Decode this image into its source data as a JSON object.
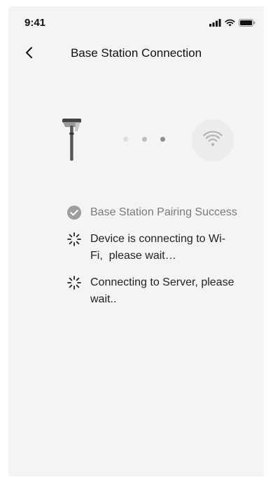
{
  "status_bar": {
    "time": "9:41",
    "icons": [
      "signal-icon",
      "wifi-icon",
      "battery-icon"
    ]
  },
  "nav": {
    "back_icon": "chevron-left-icon",
    "title": "Base Station Connection"
  },
  "illustration": {
    "device_icon": "base-station-pole-icon",
    "progress_dots": 3,
    "network_icon": "wifi-icon"
  },
  "steps": [
    {
      "icon": "check-circle-icon",
      "state": "done",
      "text": "Base Station Pairing Success"
    },
    {
      "icon": "spinner-icon",
      "state": "in-progress",
      "text": "Device is connecting to Wi-Fi,  please wait…"
    },
    {
      "icon": "spinner-icon",
      "state": "in-progress",
      "text": "Connecting to Server, please wait.."
    }
  ],
  "colors": {
    "background": "#f4f4f4",
    "done_text": "#7a7a7a",
    "active_text": "#222222",
    "check_icon": "#9e9e9e",
    "dot_light": "#dedede",
    "dot_mid": "#bdbdbd",
    "dot_dark": "#8f8f8f"
  }
}
